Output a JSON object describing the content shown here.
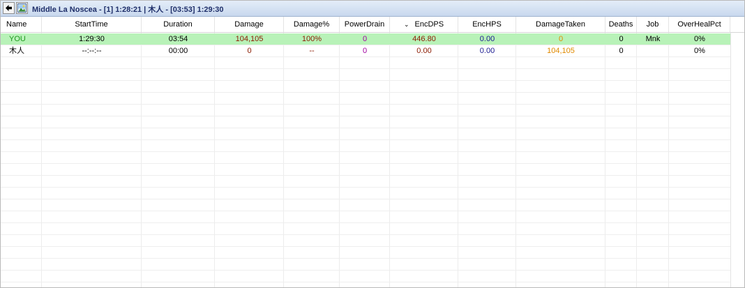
{
  "window": {
    "title": "Middle La Noscea - [1] 1:28:21 | 木人 - [03:53] 1:29:30"
  },
  "table": {
    "sort_column": "EncDPS",
    "columns": [
      {
        "key": "name",
        "label": "Name"
      },
      {
        "key": "starttime",
        "label": "StartTime"
      },
      {
        "key": "duration",
        "label": "Duration"
      },
      {
        "key": "damage",
        "label": "Damage"
      },
      {
        "key": "damagepct",
        "label": "Damage%"
      },
      {
        "key": "powerdrain",
        "label": "PowerDrain"
      },
      {
        "key": "encdps",
        "label": "EncDPS"
      },
      {
        "key": "enchps",
        "label": "EncHPS"
      },
      {
        "key": "damagetaken",
        "label": "DamageTaken"
      },
      {
        "key": "deaths",
        "label": "Deaths"
      },
      {
        "key": "job",
        "label": "Job"
      },
      {
        "key": "overhealpct",
        "label": "OverHealPct"
      }
    ],
    "rows": [
      {
        "name": "YOU",
        "starttime": "1:29:30",
        "duration": "03:54",
        "damage": "104,105",
        "damagepct": "100%",
        "powerdrain": "0",
        "encdps": "446.80",
        "enchps": "0.00",
        "damagetaken": "0",
        "deaths": "0",
        "job": "Mnk",
        "overhealpct": "0%",
        "highlighted": true
      },
      {
        "name": "木人",
        "starttime": "--:--:--",
        "duration": "00:00",
        "damage": "0",
        "damagepct": "--",
        "powerdrain": "0",
        "encdps": "0.00",
        "enchps": "0.00",
        "damagetaken": "104,105",
        "deaths": "0",
        "job": "",
        "overhealpct": "0%",
        "highlighted": false
      }
    ]
  },
  "colors": {
    "name_you": "#1f9a1f",
    "name_other": "#000000",
    "starttime": "#000000",
    "duration": "#000000",
    "damage": "#8b1a00",
    "damagepct": "#8b1a00",
    "powerdrain": "#a000a0",
    "encdps": "#8b1a00",
    "enchps": "#1a1a90",
    "damagetaken": "#e08a00",
    "deaths": "#000000",
    "job": "#000000",
    "overhealpct": "#000000",
    "highlight_row": "#b8f2b8"
  },
  "icons": {
    "back": "arrow-left-icon",
    "picture": "picture-icon",
    "sort": "sort-descending-icon"
  }
}
